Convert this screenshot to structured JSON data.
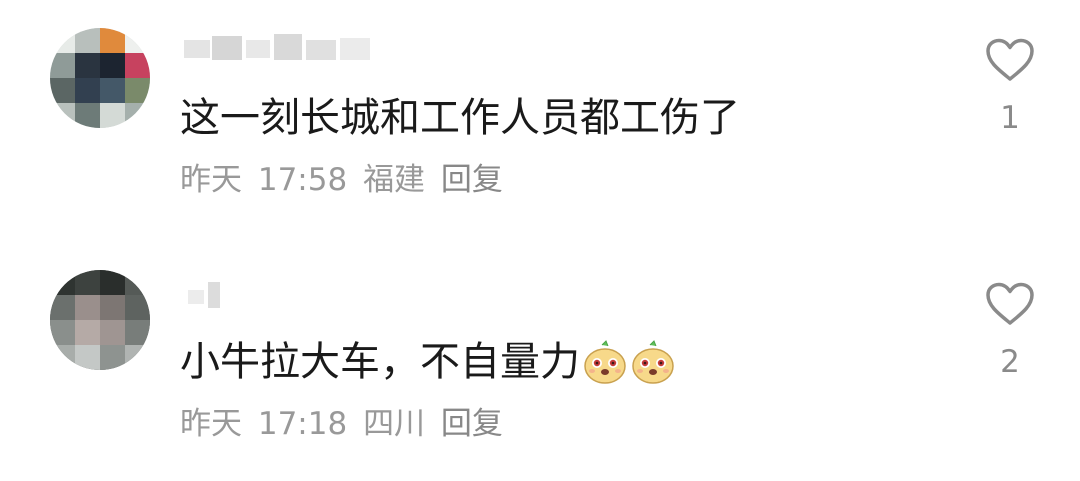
{
  "comments": [
    {
      "text": "这一刻长城和工作人员都工伤了",
      "date": "昨天",
      "time": "17:58",
      "location": "福建",
      "reply_label": "回复",
      "like_count": "1"
    },
    {
      "text": "小牛拉大车，不自量力",
      "emoji": [
        "cute-face-emoji",
        "cute-face-emoji"
      ],
      "date": "昨天",
      "time": "17:18",
      "location": "四川",
      "reply_label": "回复",
      "like_count": "2"
    }
  ],
  "icons": {
    "like": "heart-outline-icon"
  },
  "colors": {
    "text": "#1a1a1a",
    "meta": "#999999",
    "like_count": "#8a8a8a",
    "heart_stroke": "#8a8a8a"
  }
}
